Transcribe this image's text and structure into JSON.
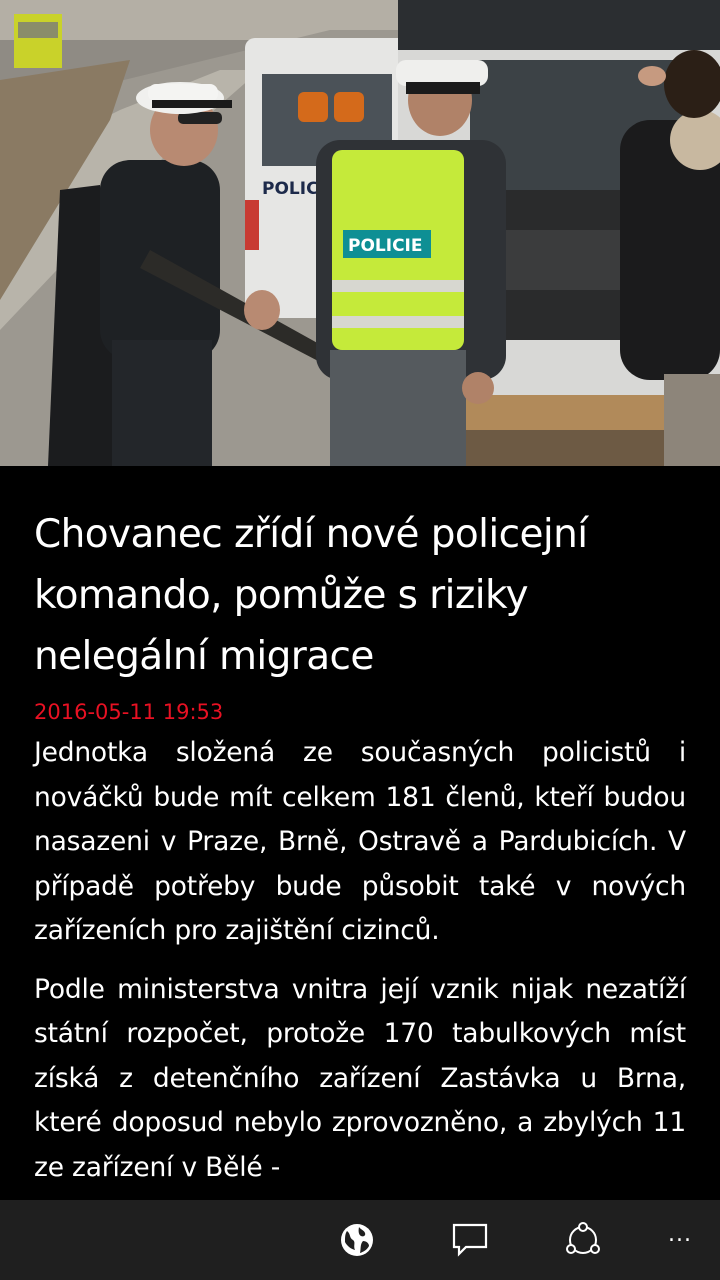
{
  "article": {
    "title": "Chovanec zřídí nové policejní komando, pomůže s riziky nelegální migrace",
    "timestamp": "2016-05-11 19:53",
    "paragraphs": [
      "Jednotka složená ze současných policistů i nováčků bude mít celkem 181 členů, kteří budou nasazeni v Praze, Brně, Ostravě a Pardubicích. V případě potřeby bude působit také v nových zařízeních pro zajištění cizinců.",
      "Podle ministerstva vnitra její vznik nijak nezatíží státní rozpočet, protože 170 tabulkových míst získá z detenčního zařízení Zastávka u Brna, které doposud nebylo zprovozněno, a zbylých 11 ze zařízení v Bělé -"
    ]
  },
  "photo": {
    "van_label": "POLICIE",
    "vest_label": "POLICIE"
  },
  "appbar": {
    "buttons": [
      {
        "icon": "globe-icon",
        "name": "open-in-browser-button"
      },
      {
        "icon": "comment-icon",
        "name": "comments-button"
      },
      {
        "icon": "share-icon",
        "name": "share-button"
      }
    ],
    "more_label": "..."
  },
  "colors": {
    "accent": "#e81123",
    "background": "#000000",
    "appbar": "#1f1f1f"
  }
}
